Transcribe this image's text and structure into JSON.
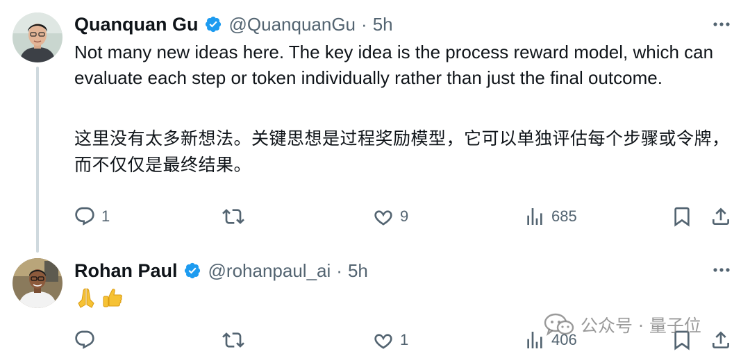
{
  "tweets": [
    {
      "author": {
        "display_name": "Quanquan Gu",
        "handle": "@QuanquanGu",
        "verified": true
      },
      "separator": "·",
      "time": "5h",
      "text_en": "Not many new ideas here. The key idea is the process reward model, which can evaluate each step or token individually rather than just the final outcome.",
      "text_zh": "这里没有太多新想法。关键思想是过程奖励模型，它可以单独评估每个步骤或令牌，而不仅仅是最终结果。",
      "stats": {
        "replies": "1",
        "retweets": "",
        "likes": "9",
        "views": "685"
      }
    },
    {
      "author": {
        "display_name": "Rohan Paul",
        "handle": "@rohanpaul_ai",
        "verified": true
      },
      "separator": "·",
      "time": "5h",
      "emojis": [
        "🙏",
        "👍"
      ],
      "stats": {
        "replies": "",
        "retweets": "",
        "likes": "1",
        "views": "406"
      }
    }
  ],
  "icons": {
    "verified": "verified-badge-icon",
    "more": "more-horizontal-icon",
    "reply": "reply-icon",
    "retweet": "retweet-icon",
    "like": "heart-icon",
    "views": "views-chart-icon",
    "bookmark": "bookmark-icon",
    "share": "share-icon"
  },
  "colors": {
    "verified_blue": "#1d9bf0",
    "text_primary": "#0f1419",
    "text_secondary": "#536471",
    "thread_line": "#cfd9de"
  },
  "watermark": {
    "text": "公众号 · 量子位"
  }
}
